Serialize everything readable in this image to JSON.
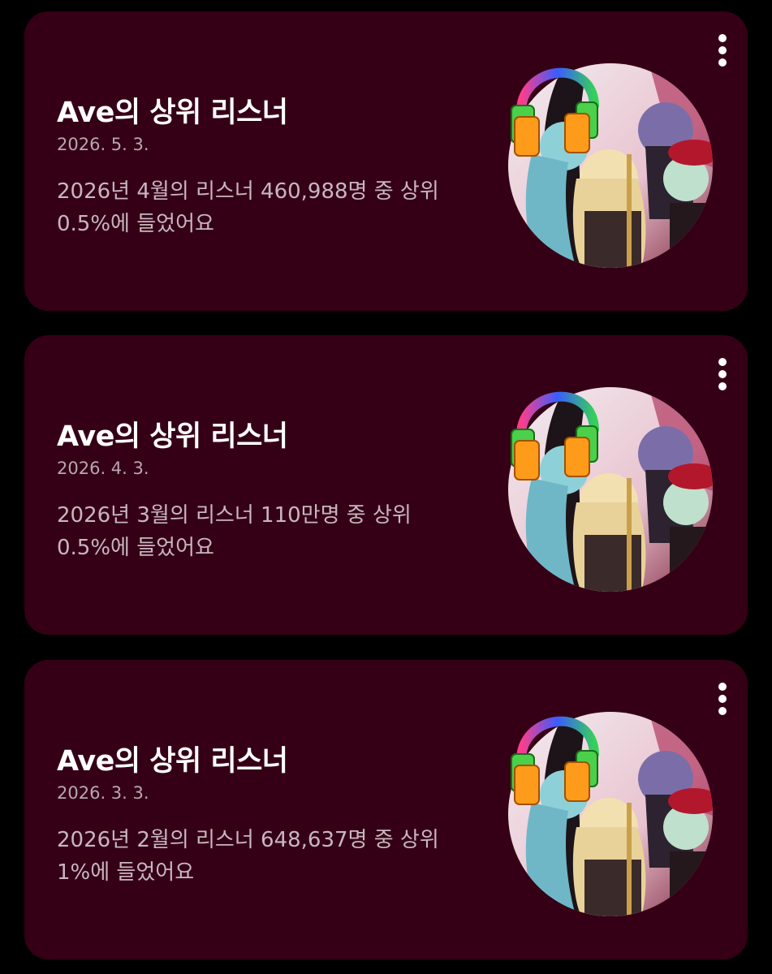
{
  "cards": [
    {
      "title": "Ave의 상위 리스너",
      "date": "2026. 5. 3.",
      "description": "2026년 4월의 리스너 460,988명 중 상위 0.5%에 들었어요"
    },
    {
      "title": "Ave의 상위 리스너",
      "date": "2026. 4. 3.",
      "description": "2026년 3월의 리스너 110만명 중 상위 0.5%에 들었어요"
    },
    {
      "title": "Ave의 상위 리스너",
      "date": "2026. 3. 3.",
      "description": "2026년 2월의 리스너 648,637명 중 상위 1%에 들었어요"
    }
  ],
  "theme": {
    "background": "#000000",
    "card_background": "#350016",
    "title_color": "#ffffff",
    "secondary_text": "#c8b7be"
  },
  "icons": {
    "menu": "more-vertical-icon",
    "art": "artist-artwork"
  }
}
